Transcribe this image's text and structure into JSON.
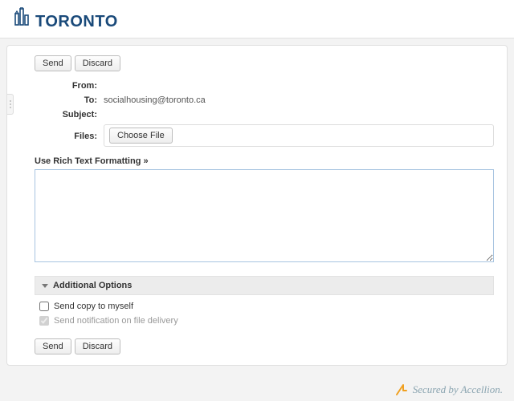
{
  "brand": {
    "name": "TORONTO"
  },
  "buttons": {
    "send": "Send",
    "discard": "Discard",
    "choose_file": "Choose File"
  },
  "labels": {
    "from": "From:",
    "to": "To:",
    "subject": "Subject:",
    "files": "Files:",
    "rtf": "Use Rich Text Formatting",
    "rtf_arrow": "»",
    "additional_options": "Additional Options",
    "send_copy": "Send copy to myself",
    "send_notify": "Send notification on file delivery"
  },
  "values": {
    "from": "",
    "to": "socialhousing@toronto.ca",
    "subject": "",
    "body": ""
  },
  "options": {
    "send_copy_checked": false,
    "send_notify_checked": true,
    "send_notify_disabled": true
  },
  "footer": {
    "text": "Secured by Accellion."
  }
}
